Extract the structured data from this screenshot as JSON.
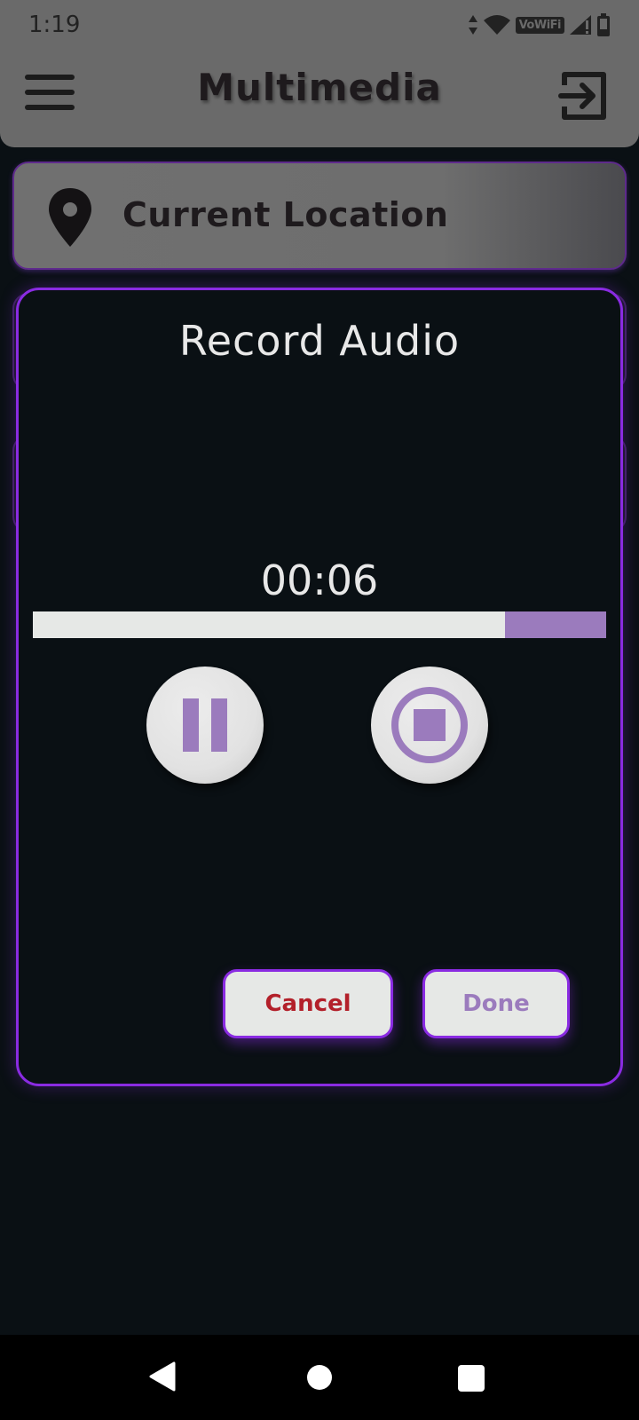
{
  "status_bar": {
    "time": "1:19",
    "vowifi_label": "VoWiFi",
    "icons": [
      "data-arrows-icon",
      "wifi-icon",
      "vowifi-icon",
      "signal-icon",
      "battery-icon"
    ]
  },
  "app_bar": {
    "title": "Multimedia",
    "menu_icon": "menu-icon",
    "logout_icon": "logout-icon"
  },
  "location_card": {
    "label": "Current Location",
    "icon": "location-pin-icon"
  },
  "dialog": {
    "title": "Record Audio",
    "timer": "00:06",
    "progress_fraction": 0.823,
    "pause_icon": "pause-icon",
    "stop_icon": "stop-icon",
    "cancel_label": "Cancel",
    "done_label": "Done"
  },
  "colors": {
    "accent_purple": "#8a2be2",
    "control_purple": "#9b7bbd",
    "cancel_red": "#b3202a",
    "app_bar_gray": "#6a6a6a",
    "background": "#0a1014"
  },
  "nav_bar": {
    "icons": [
      "back-icon",
      "home-icon",
      "recents-icon"
    ]
  }
}
